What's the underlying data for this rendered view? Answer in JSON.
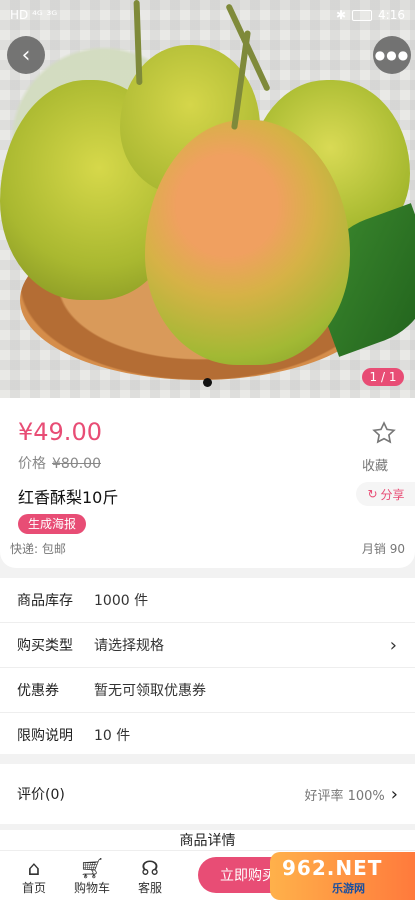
{
  "status_bar": {
    "left": "HD  ⁴ᴳ  ³ᴳ",
    "bluetooth": "✱",
    "time": "4:16"
  },
  "gallery": {
    "counter": "1 / 1"
  },
  "product": {
    "price": "¥49.00",
    "orig_price_label": "价格",
    "orig_price": "¥80.00",
    "fav_label": "收藏",
    "title": "红香酥梨10斤",
    "share_label": "分享",
    "poster_label": "生成海报",
    "shipping": "快递: 包邮",
    "sales": "月销 90"
  },
  "info": {
    "rows": [
      {
        "key": "商品库存",
        "value": "1000 件"
      },
      {
        "key": "购买类型",
        "value": "请选择规格"
      },
      {
        "key": "优惠券",
        "value": "暂无可领取优惠券"
      },
      {
        "key": "限购说明",
        "value": "10 件"
      }
    ]
  },
  "review": {
    "label": "评价(0)",
    "rate": "好评率 100%"
  },
  "details_title": "商品详情",
  "bottom_bar": {
    "home": "首页",
    "cart": "购物车",
    "service": "客服",
    "buy": "立即购买"
  },
  "watermark": {
    "brand": "962.NET",
    "sub": "乐游网"
  },
  "colors": {
    "accent": "#e84d75"
  }
}
